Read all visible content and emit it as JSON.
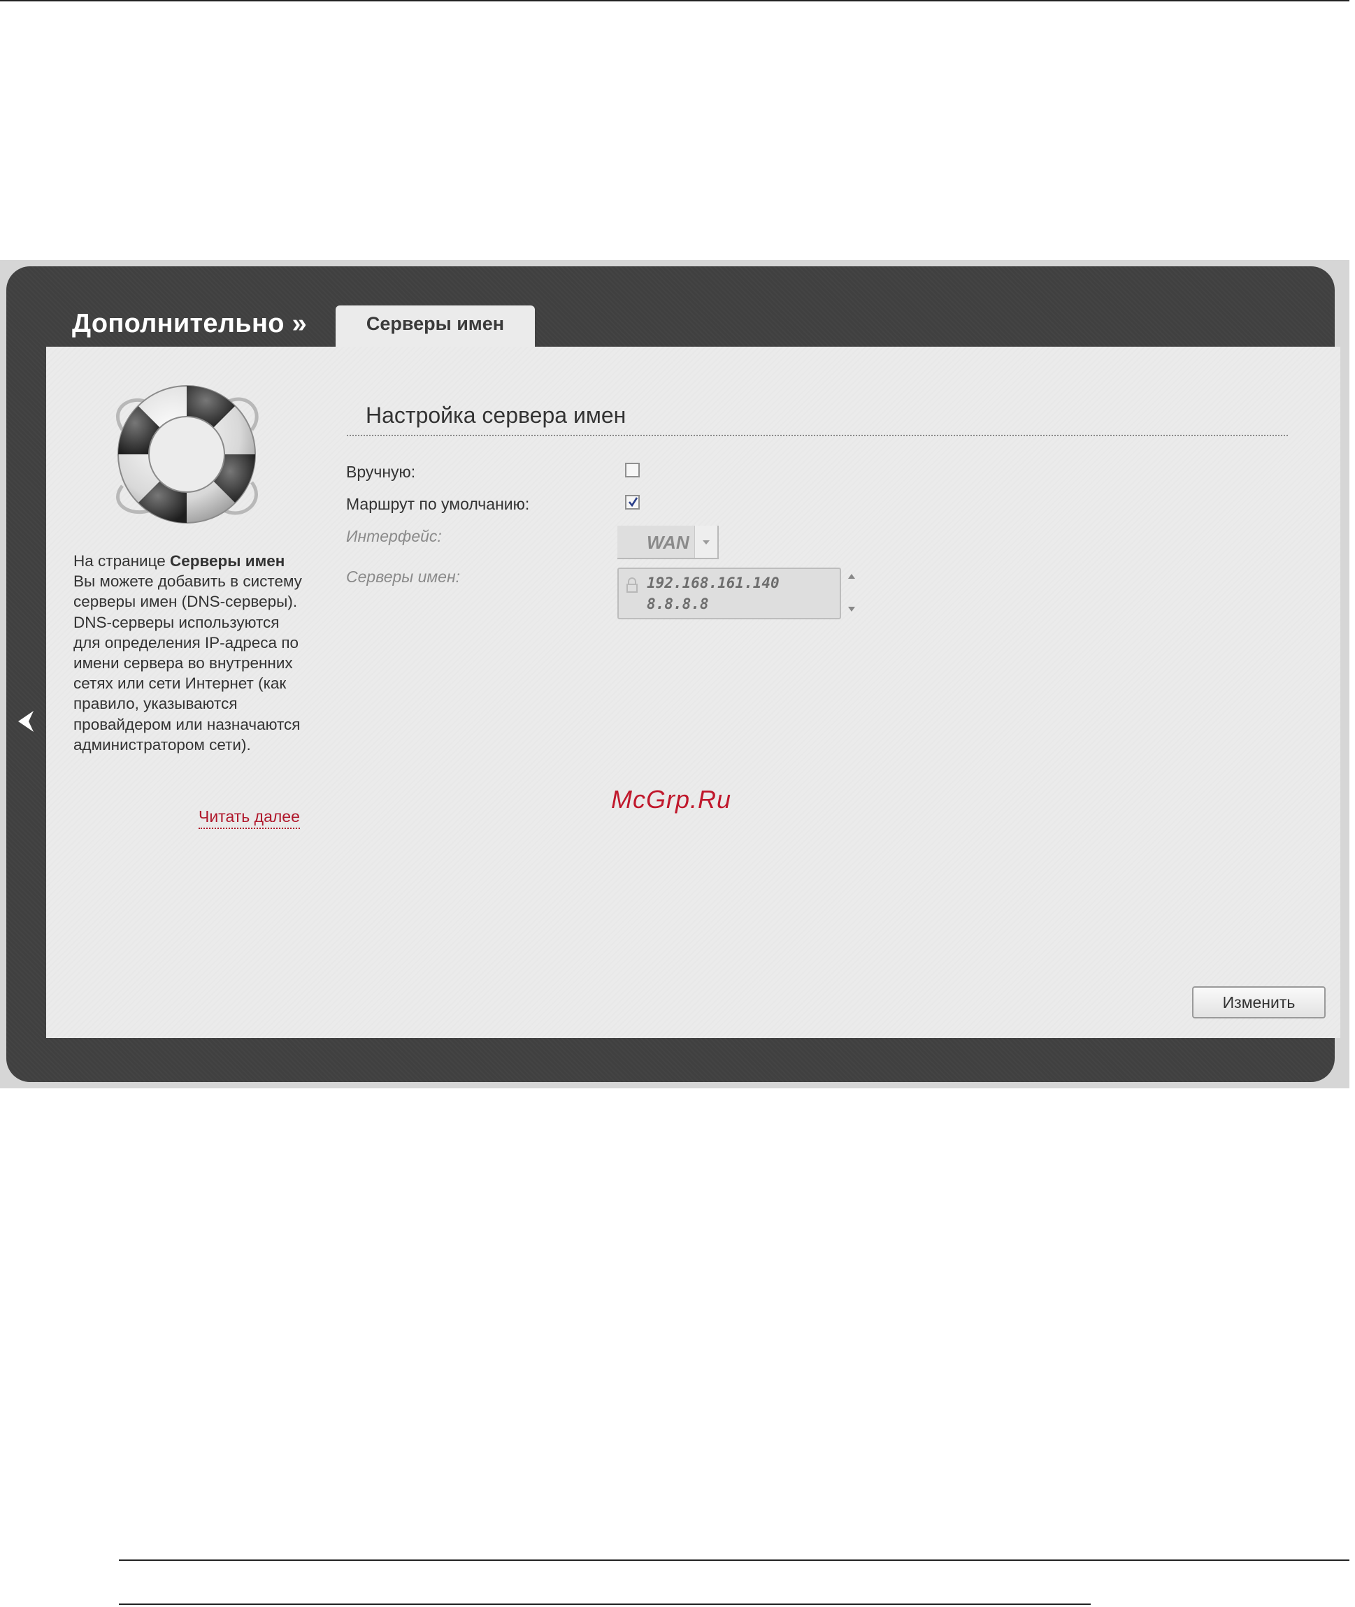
{
  "header": {
    "section_title": "Дополнительно »",
    "tab_label": "Серверы имен"
  },
  "sidebar": {
    "help_intro": "На странице ",
    "help_bold": "Серверы имен",
    "help_body": "Вы можете добавить в систему серверы имен (DNS-серверы). DNS-серверы используются для определения IP-адреса по имени сервера во внутренних сетях или сети Интернет (как правило, указываются провайдером или назначаются администратором сети).",
    "read_more": "Читать далее"
  },
  "form": {
    "title": "Настройка сервера имен",
    "manual_label": "Вручную:",
    "manual_checked": false,
    "default_route_label": "Маршрут по умолчанию:",
    "default_route_checked": true,
    "interface_label": "Интерфейс:",
    "interface_value": "WAN",
    "servers_label": "Серверы имен:",
    "servers": [
      "192.168.161.140",
      "8.8.8.8"
    ]
  },
  "buttons": {
    "change": "Изменить"
  },
  "watermark": "McGrp.Ru",
  "colors": {
    "frame": "#404040",
    "panel": "#ebebeb",
    "link": "#b0182c",
    "watermark": "#c0182c"
  },
  "icons": [
    "back-arrow-icon",
    "lifebuoy-icon",
    "checkbox-check-icon",
    "lock-icon",
    "chevron-down-icon",
    "scroll-up-icon",
    "scroll-down-icon"
  ]
}
